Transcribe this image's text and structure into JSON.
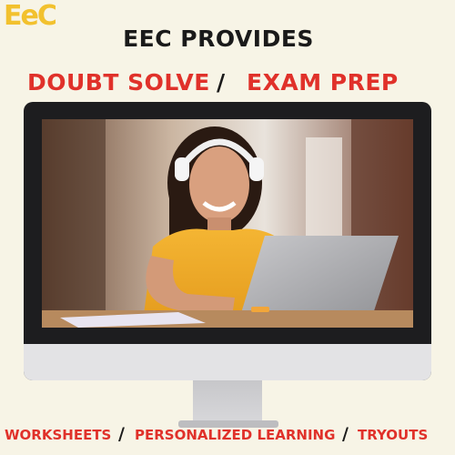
{
  "logo": {
    "text": "EeC"
  },
  "header": {
    "title": "EEC PROVIDES",
    "service_1": "DOUBT SOLVE",
    "separator": "/",
    "service_2": "EXAM PREP"
  },
  "screen": {
    "image_description": "student with headphones using laptop"
  },
  "footer": {
    "item_1": "WORKSHEETS",
    "item_2": "PERSONALIZED LEARNING",
    "item_3": "TRYOUTS",
    "separator": "/"
  },
  "colors": {
    "accent_red": "#e0312a",
    "logo_yellow": "#f2c12e",
    "background": "#f7f4e6",
    "monitor_bezel": "#1d1d1f"
  }
}
